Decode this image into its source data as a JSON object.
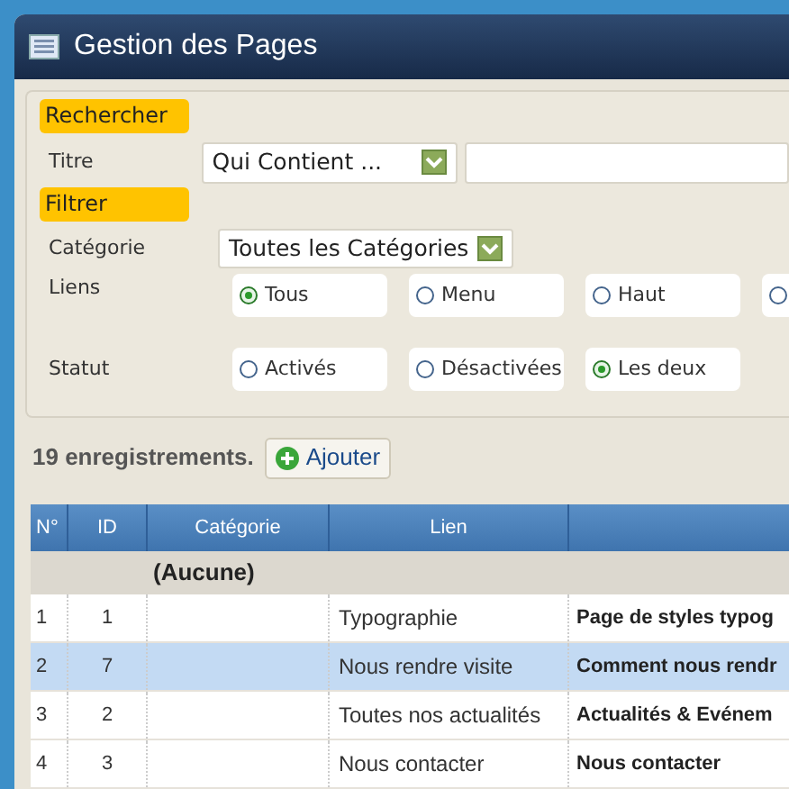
{
  "window": {
    "title": "Gestion des Pages"
  },
  "search": {
    "heading": "Rechercher",
    "title_label": "Titre",
    "operator": "Qui Contient ..."
  },
  "filter": {
    "heading": "Filtrer",
    "category_label": "Catégorie",
    "category": "Toutes les Catégories",
    "links_label": "Liens",
    "links": [
      {
        "label": "Tous",
        "selected": true
      },
      {
        "label": "Menu",
        "selected": false
      },
      {
        "label": "Haut",
        "selected": false
      },
      {
        "selected": false
      }
    ],
    "status_label": "Statut",
    "status": [
      {
        "label": "Activés",
        "selected": false
      },
      {
        "label": "Désactivées",
        "selected": false
      },
      {
        "label": "Les deux",
        "selected": true
      }
    ]
  },
  "count": "19 enregistrements.",
  "add_button": "Ajouter",
  "table": {
    "columns": [
      "N°",
      "ID",
      "Catégorie",
      "Lien"
    ],
    "group": "(Aucune)",
    "rows": [
      {
        "n": "1",
        "id": "1",
        "link": "Typographie",
        "title": "Page de styles typog",
        "selected": false
      },
      {
        "n": "2",
        "id": "7",
        "link": "Nous rendre visite",
        "title": "Comment nous rendr",
        "selected": true
      },
      {
        "n": "3",
        "id": "2",
        "link": "Toutes nos actualités",
        "title": "Actualités & Evénem",
        "selected": false
      },
      {
        "n": "4",
        "id": "3",
        "link": "Nous contacter",
        "title": "Nous contacter",
        "selected": false
      }
    ]
  }
}
